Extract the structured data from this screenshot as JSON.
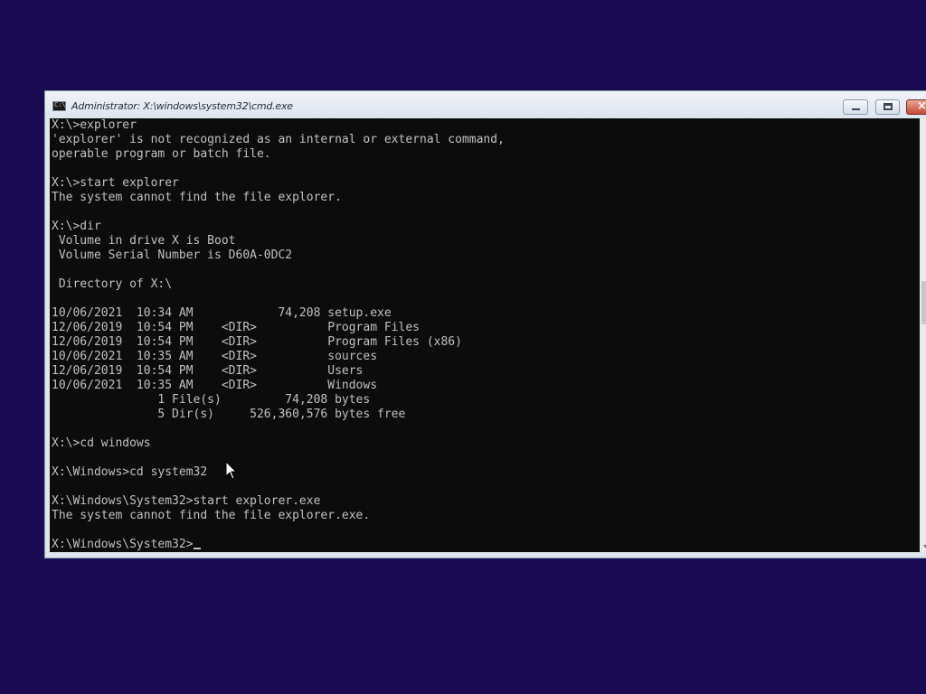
{
  "window": {
    "title": "Administrator: X:\\windows\\system32\\cmd.exe",
    "controls": {
      "minimize": "minimize",
      "maximize": "maximize",
      "close": "close"
    }
  },
  "console": {
    "lines": [
      "X:\\>explorer",
      "'explorer' is not recognized as an internal or external command,",
      "operable program or batch file.",
      "",
      "X:\\>start explorer",
      "The system cannot find the file explorer.",
      "",
      "X:\\>dir",
      " Volume in drive X is Boot",
      " Volume Serial Number is D60A-0DC2",
      "",
      " Directory of X:\\",
      "",
      "10/06/2021  10:34 AM            74,208 setup.exe",
      "12/06/2019  10:54 PM    <DIR>          Program Files",
      "12/06/2019  10:54 PM    <DIR>          Program Files (x86)",
      "10/06/2021  10:35 AM    <DIR>          sources",
      "12/06/2019  10:54 PM    <DIR>          Users",
      "10/06/2021  10:35 AM    <DIR>          Windows",
      "               1 File(s)         74,208 bytes",
      "               5 Dir(s)     526,360,576 bytes free",
      "",
      "X:\\>cd windows",
      "",
      "X:\\Windows>cd system32",
      "",
      "X:\\Windows\\System32>start explorer.exe",
      "The system cannot find the file explorer.exe.",
      ""
    ],
    "prompt": "X:\\Windows\\System32>"
  },
  "colors": {
    "desktop": "#1a0a52",
    "console_bg": "#0c0c0c",
    "console_text": "#c0c0c0"
  }
}
